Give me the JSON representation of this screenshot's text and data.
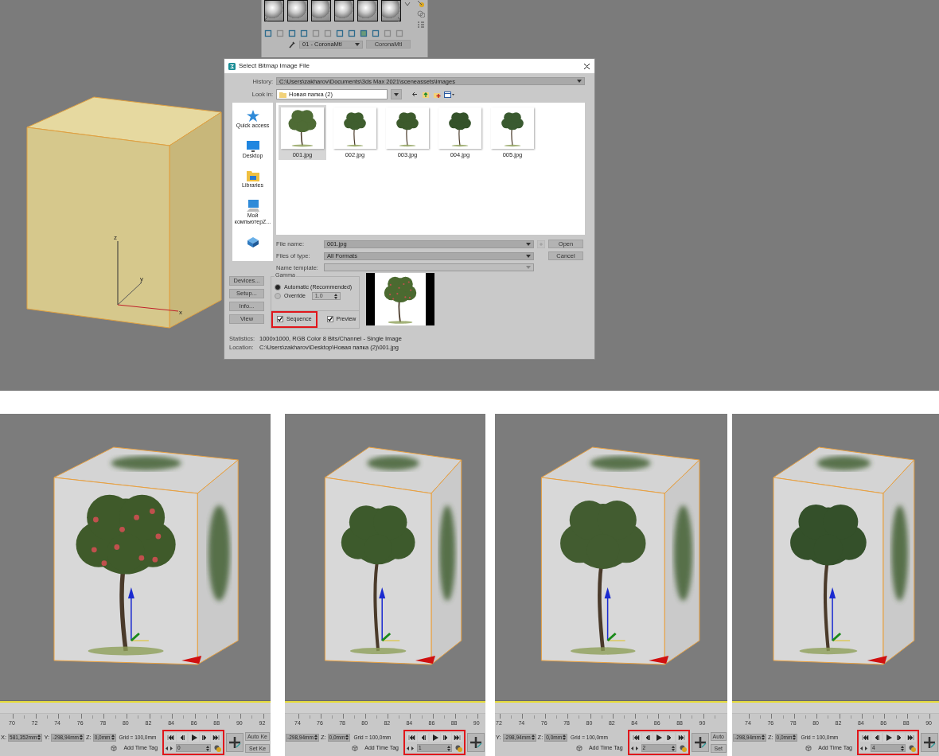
{
  "material_editor": {
    "material_name": "01 - CoronaMtl",
    "material_type": "CoronaMtl"
  },
  "scene_gizmo": {
    "axes": [
      "z",
      "y",
      "x"
    ]
  },
  "dialog": {
    "title": "Select Bitmap Image File",
    "history_label": "History:",
    "history": "C:\\Users\\zakharov\\Documents\\3ds Max 2021\\sceneassets\\images",
    "look_in_label": "Look in:",
    "look_in": "Новая папка (2)",
    "places": [
      {
        "label": "Quick access",
        "kind": "star"
      },
      {
        "label": "Desktop",
        "kind": "desktop"
      },
      {
        "label": "Libraries",
        "kind": "libraries"
      },
      {
        "label": "Мой компьютерZ...",
        "kind": "computer"
      },
      {
        "kind": "network"
      }
    ],
    "files": [
      {
        "name": "001.jpg",
        "selected": true
      },
      {
        "name": "002.jpg",
        "selected": false
      },
      {
        "name": "003.jpg",
        "selected": false
      },
      {
        "name": "004.jpg",
        "selected": false
      },
      {
        "name": "005.jpg",
        "selected": false
      }
    ],
    "file_name_label": "File name:",
    "file_name": "001.jpg",
    "files_of_type_label": "Files of type:",
    "files_of_type": "All Formats",
    "name_template_label": "Name template:",
    "open": "Open",
    "cancel": "Cancel",
    "side_buttons": [
      "Devices...",
      "Setup...",
      "Info...",
      "View"
    ],
    "gamma_title": "Gamma",
    "gamma_options": [
      {
        "label": "Automatic (Recommended)",
        "selected": true
      },
      {
        "label": "Override",
        "selected": false
      }
    ],
    "override_value": "1.0",
    "checkboxes": [
      {
        "label": "Sequence",
        "checked": true,
        "highlighted": true
      },
      {
        "label": "Preview",
        "checked": true,
        "highlighted": false
      }
    ],
    "statistics_label": "Statistics:",
    "statistics": "1000x1000, RGB Color 8 Bits/Channel - Single Image",
    "location_label": "Location:",
    "location": "C:\\Users\\zakharov\\Desktop\\Новая папка (2)\\001.jpg"
  },
  "frames": [
    {
      "ruler_labels": [
        "70",
        "72",
        "74",
        "76",
        "78",
        "80",
        "82",
        "84",
        "86",
        "88",
        "90",
        "92"
      ],
      "coordinates": [
        {
          "label": "X:",
          "value": "581,352mm"
        },
        {
          "label": "Y:",
          "value": "-298,94mm"
        },
        {
          "label": "Z:",
          "value": "0,0mm"
        }
      ],
      "grid": "Grid = 100,0mm",
      "add_time_tag": "Add Time Tag",
      "frame": "0",
      "highlighted": true,
      "key_buttons": [
        "Auto Ke",
        "Set Ke"
      ]
    },
    {
      "ruler_labels": [
        "74",
        "76",
        "78",
        "80",
        "82",
        "84",
        "86",
        "88",
        "90"
      ],
      "coordinates": [
        {
          "value": "-298,94mm"
        },
        {
          "label": "Z:",
          "value": "0,0mm"
        }
      ],
      "grid": "Grid = 100,0mm",
      "add_time_tag": "Add Time Tag",
      "frame": "1",
      "highlighted": true
    },
    {
      "ruler_labels": [
        "72",
        "74",
        "76",
        "78",
        "80",
        "82",
        "84",
        "86",
        "88",
        "90"
      ],
      "coordinates": [
        {
          "label": "Y:",
          "value": "-298,94mm"
        },
        {
          "label": "Z:",
          "value": "0,0mm"
        }
      ],
      "grid": "Grid = 100,0mm",
      "add_time_tag": "Add Time Tag",
      "frame": "2",
      "highlighted": true,
      "key_buttons": [
        "Auto",
        "Set"
      ]
    },
    {
      "ruler_labels": [
        "74",
        "76",
        "78",
        "80",
        "82",
        "84",
        "86",
        "88",
        "90"
      ],
      "coordinates": [
        {
          "value": "-298,94mm"
        },
        {
          "label": "Z:",
          "value": "0,0mm"
        }
      ],
      "grid": "Grid = 100,0mm",
      "add_time_tag": "Add Time Tag",
      "frame": "4",
      "highlighted": true
    }
  ]
}
